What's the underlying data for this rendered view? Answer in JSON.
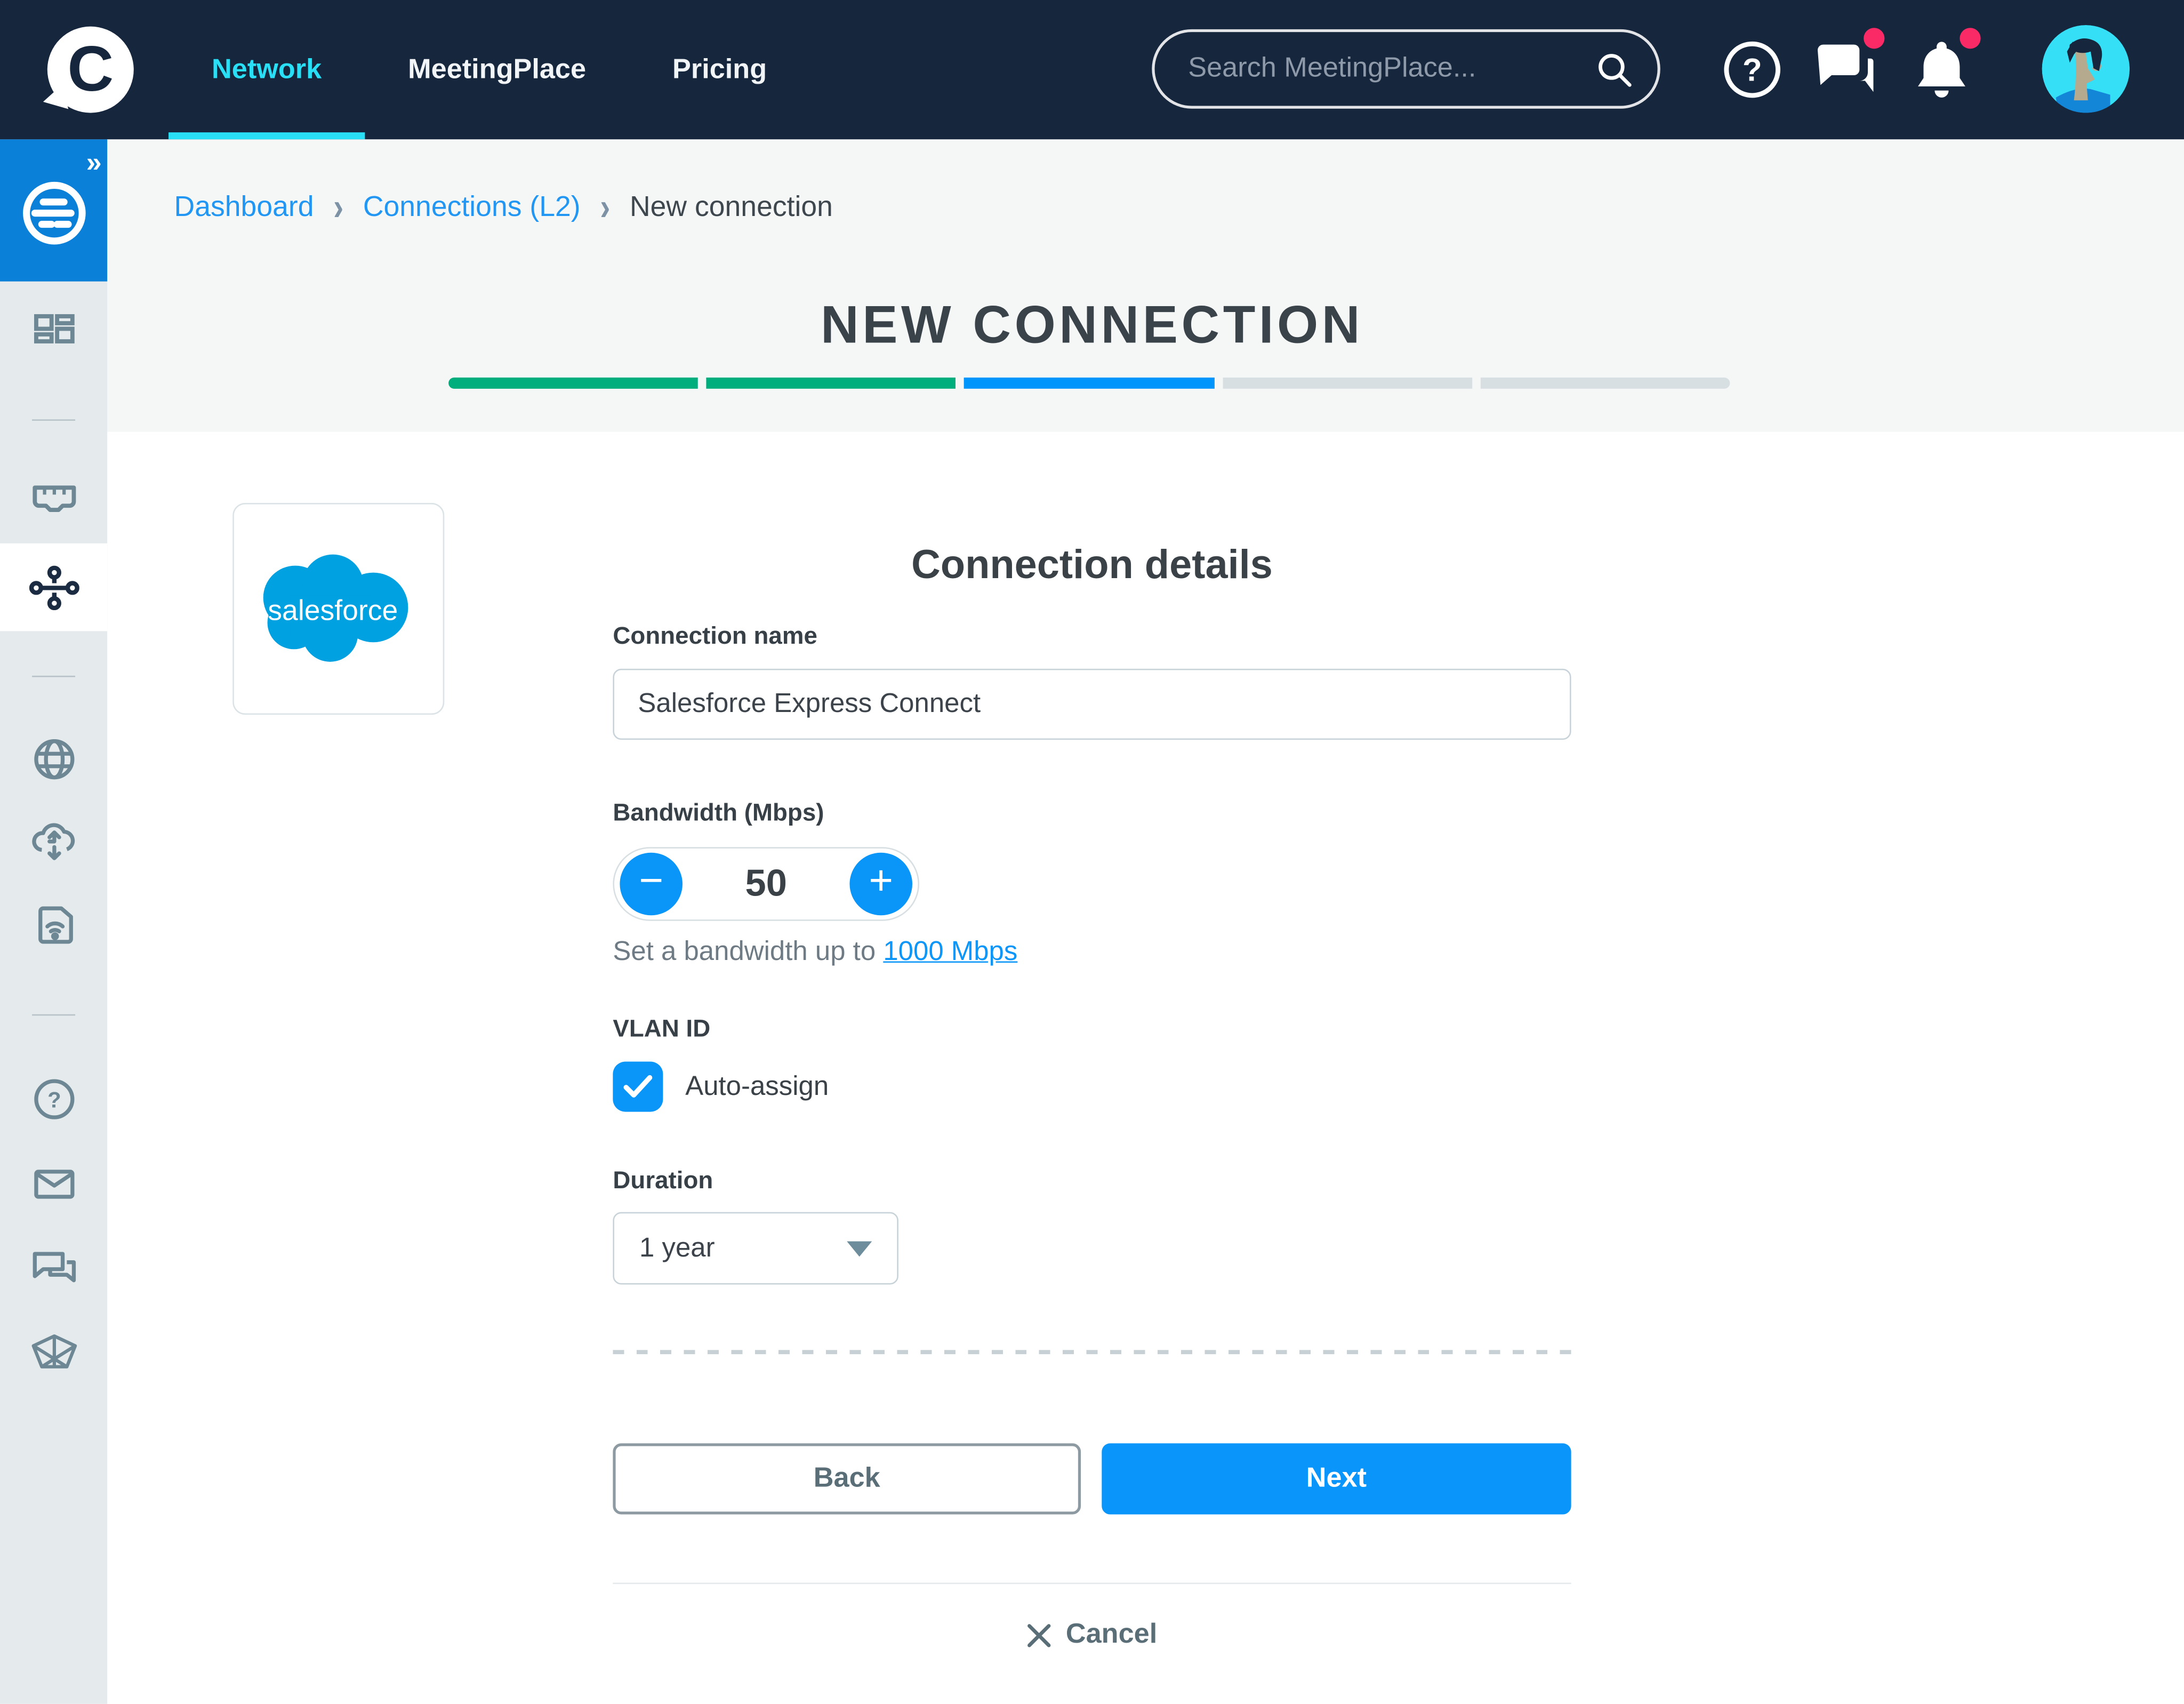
{
  "topbar": {
    "brand_letter": "C",
    "nav": [
      {
        "label": "Network",
        "active": true
      },
      {
        "label": "MeetingPlace",
        "active": false
      },
      {
        "label": "Pricing",
        "active": false
      }
    ],
    "search": {
      "placeholder": "Search MeetingPlace..."
    },
    "icons": [
      {
        "name": "help-icon",
        "badge": false
      },
      {
        "name": "messages-icon",
        "badge": true
      },
      {
        "name": "notifications-icon",
        "badge": true
      }
    ]
  },
  "sidebar": {
    "expand_glyph": "»",
    "items": [
      {
        "name": "network-logo",
        "active": false
      },
      {
        "name": "dashboard",
        "active": false
      },
      {
        "name": "ports",
        "active": false
      },
      {
        "name": "connections",
        "active": true
      },
      {
        "name": "internet",
        "active": false
      },
      {
        "name": "cloud-routing",
        "active": false
      },
      {
        "name": "edge-sim",
        "active": false
      },
      {
        "name": "help",
        "active": false
      },
      {
        "name": "mail",
        "active": false
      },
      {
        "name": "chat",
        "active": false
      },
      {
        "name": "mesh",
        "active": false
      }
    ]
  },
  "breadcrumb": {
    "separator": "›",
    "items": [
      {
        "label": "Dashboard",
        "link": true
      },
      {
        "label": "Connections (L2)",
        "link": true
      },
      {
        "label": "New connection",
        "link": false
      }
    ]
  },
  "page": {
    "title": "NEW CONNECTION"
  },
  "wizard": {
    "steps": [
      {
        "state": "done"
      },
      {
        "state": "done"
      },
      {
        "state": "current"
      },
      {
        "state": "upcoming"
      },
      {
        "state": "upcoming"
      }
    ]
  },
  "form": {
    "heading": "Connection details",
    "provider": {
      "name": "salesforce",
      "wordmark": "salesforce"
    },
    "connection_name": {
      "label": "Connection name",
      "value": "Salesforce Express Connect"
    },
    "bandwidth": {
      "label": "Bandwidth (Mbps)",
      "value": "50",
      "minus_glyph": "−",
      "plus_glyph": "+",
      "hint_prefix": "Set a bandwidth up to ",
      "hint_link": "1000 Mbps"
    },
    "vlan": {
      "label": "VLAN ID",
      "checkbox_label": "Auto-assign",
      "checked": true
    },
    "duration": {
      "label": "Duration",
      "value": "1 year"
    },
    "actions": {
      "back": "Back",
      "next": "Next",
      "cancel": "Cancel"
    }
  },
  "colors": {
    "topbar_bg": "#16263d",
    "nav_active": "#28dff6",
    "accent_blue": "#0095fa",
    "progress_green": "#00ad7d",
    "progress_gray": "#d8dfe3",
    "badge_pink": "#fa2a67",
    "sidebar_bg": "#e5eaec",
    "sidebar_icon": "#6d8894",
    "band_bg": "#f5f7f7",
    "salesforce_blue": "#00a1e0",
    "link_blue": "#2196f3",
    "text_dark": "#3a4147",
    "text_gray": "#5a6e78"
  }
}
